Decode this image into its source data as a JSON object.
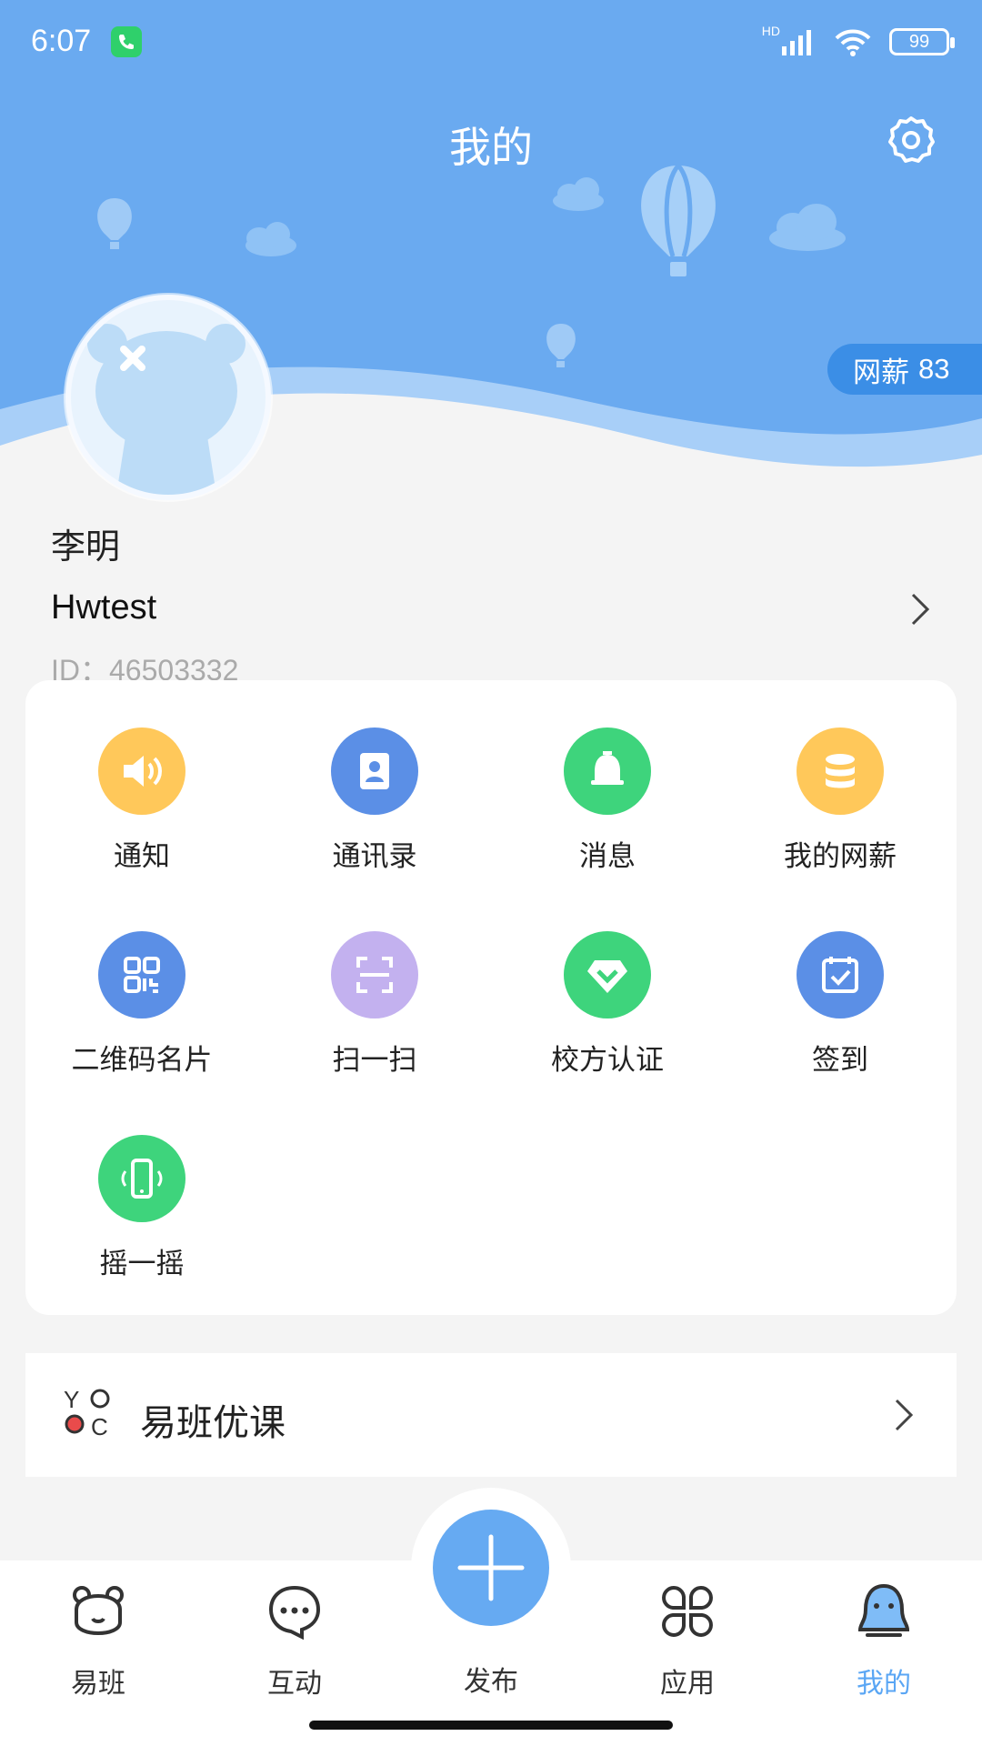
{
  "status_bar": {
    "time": "6:07",
    "battery": "99",
    "network": "HD"
  },
  "header": {
    "title": "我的"
  },
  "profile": {
    "coin_label": "网薪",
    "coin_value": "83",
    "name": "李明",
    "username": "Hwtest",
    "id_text": "ID：46503332"
  },
  "grid": [
    {
      "label": "通知",
      "icon": "speaker-icon",
      "color": "#ffc85a"
    },
    {
      "label": "通讯录",
      "icon": "contact-book-icon",
      "color": "#5b8fe6"
    },
    {
      "label": "消息",
      "icon": "bell-icon",
      "color": "#3ed47c"
    },
    {
      "label": "我的网薪",
      "icon": "coins-icon",
      "color": "#ffc85a"
    },
    {
      "label": "二维码名片",
      "icon": "qr-code-icon",
      "color": "#5b8fe6"
    },
    {
      "label": "扫一扫",
      "icon": "scan-icon",
      "color": "#c3b1ef"
    },
    {
      "label": "校方认证",
      "icon": "diamond-check-icon",
      "color": "#3ed47c"
    },
    {
      "label": "签到",
      "icon": "calendar-check-icon",
      "color": "#5b8fe6"
    },
    {
      "label": "摇一摇",
      "icon": "shake-phone-icon",
      "color": "#3ed47c"
    }
  ],
  "course": {
    "title": "易班优课"
  },
  "bottom_nav": [
    {
      "label": "易班",
      "icon": "bear-icon",
      "active": false
    },
    {
      "label": "互动",
      "icon": "chat-bubble-icon",
      "active": false
    },
    {
      "label": "发布",
      "icon": "plus-icon",
      "active": false
    },
    {
      "label": "应用",
      "icon": "apps-icon",
      "active": false
    },
    {
      "label": "我的",
      "icon": "profile-blob-icon",
      "active": true
    }
  ],
  "colors": {
    "header": "#6aaaf0",
    "active_tab": "#5aa6f4",
    "fab": "#66aaf2"
  }
}
